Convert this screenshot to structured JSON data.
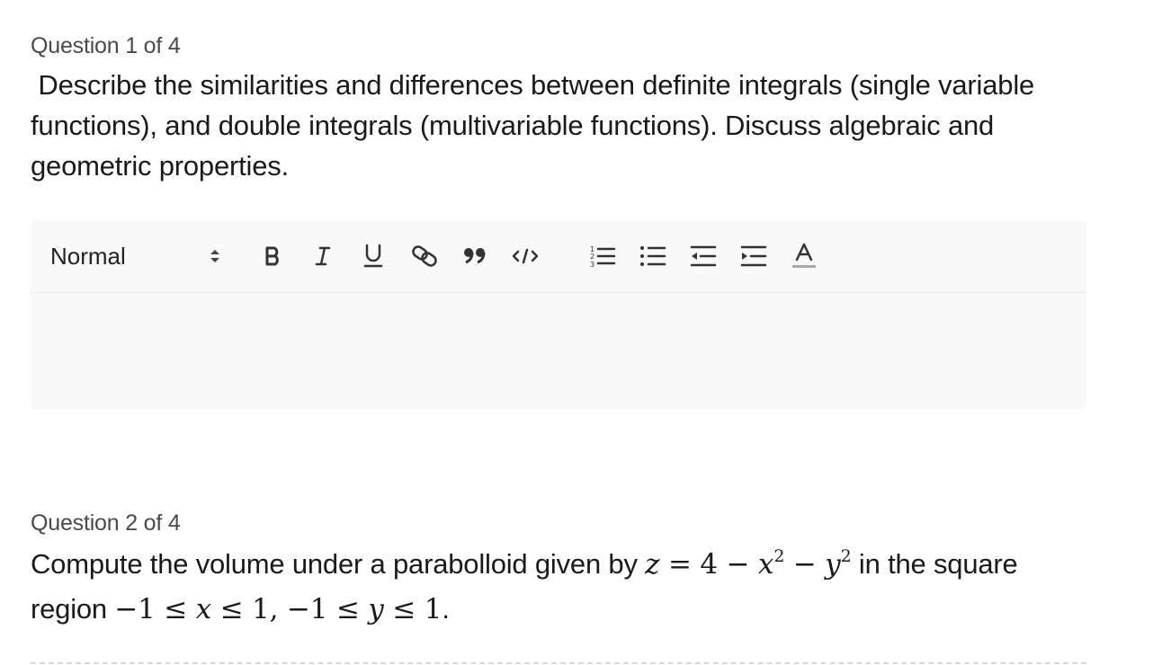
{
  "questions": [
    {
      "label": "Question 1 of 4",
      "text": " Describe the similarities and differences between definite integrals (single variable functions), and double integrals (multivariable functions). Discuss algebraic and geometric properties."
    },
    {
      "label": "Question 2 of 4",
      "text_before": "Compute the volume under a parabolloid given by ",
      "text_middle": " in the square region ",
      "text_after": "."
    }
  ],
  "editor": {
    "format_select_value": "Normal",
    "toolbar_icons": [
      "bold-icon",
      "italic-icon",
      "underline-icon",
      "link-icon",
      "blockquote-icon",
      "code-icon",
      "ordered-list-icon",
      "bullet-list-icon",
      "outdent-icon",
      "indent-icon",
      "text-color-icon"
    ],
    "content": ""
  },
  "colors": {
    "editor_background": "#f9f9fa",
    "label_text": "#4a4a4a",
    "toolbar_icon": "#333333"
  }
}
